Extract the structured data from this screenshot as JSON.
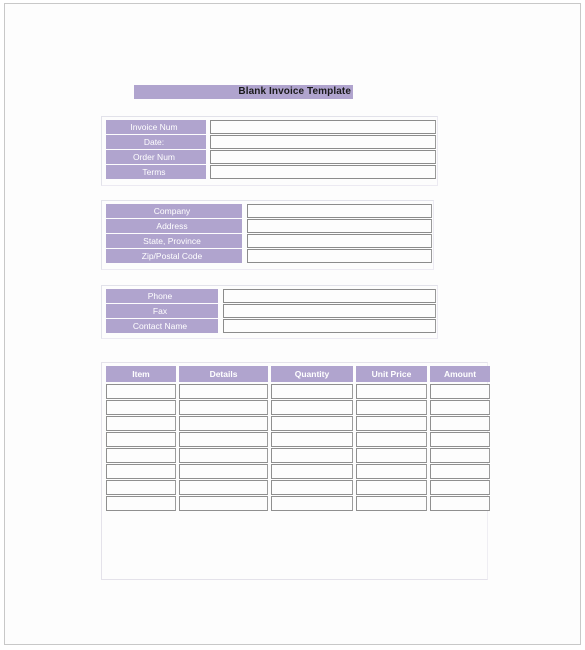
{
  "document": {
    "title": "Blank Invoice Template",
    "accent_color": "#b0a4ce",
    "label_text_color": "#ffffff",
    "page_background": "#fdfdfd"
  },
  "title_bar": {
    "text": "Blank Invoice Template"
  },
  "blocks": [
    {
      "id": "invoice-details",
      "rows": [
        {
          "label": "Invoice Num",
          "value": ""
        },
        {
          "label": "Date:",
          "value": ""
        },
        {
          "label": "Order Num",
          "value": ""
        },
        {
          "label": "Terms",
          "value": ""
        }
      ]
    },
    {
      "id": "company-details",
      "rows": [
        {
          "label": "Company",
          "value": ""
        },
        {
          "label": "Address",
          "value": ""
        },
        {
          "label": "State, Province",
          "value": ""
        },
        {
          "label": "Zip/Postal Code",
          "value": ""
        }
      ]
    },
    {
      "id": "contact-details",
      "rows": [
        {
          "label": "Phone",
          "value": ""
        },
        {
          "label": "Fax",
          "value": ""
        },
        {
          "label": "Contact Name",
          "value": ""
        }
      ]
    }
  ],
  "items_table": {
    "headers": [
      "Item",
      "Details",
      "Quantity",
      "Unit Price",
      "Amount"
    ],
    "rows": [
      [
        "",
        "",
        "",
        "",
        ""
      ],
      [
        "",
        "",
        "",
        "",
        ""
      ],
      [
        "",
        "",
        "",
        "",
        ""
      ],
      [
        "",
        "",
        "",
        "",
        ""
      ],
      [
        "",
        "",
        "",
        "",
        ""
      ],
      [
        "",
        "",
        "",
        "",
        ""
      ],
      [
        "",
        "",
        "",
        "",
        ""
      ],
      [
        "",
        "",
        "",
        "",
        ""
      ]
    ]
  }
}
